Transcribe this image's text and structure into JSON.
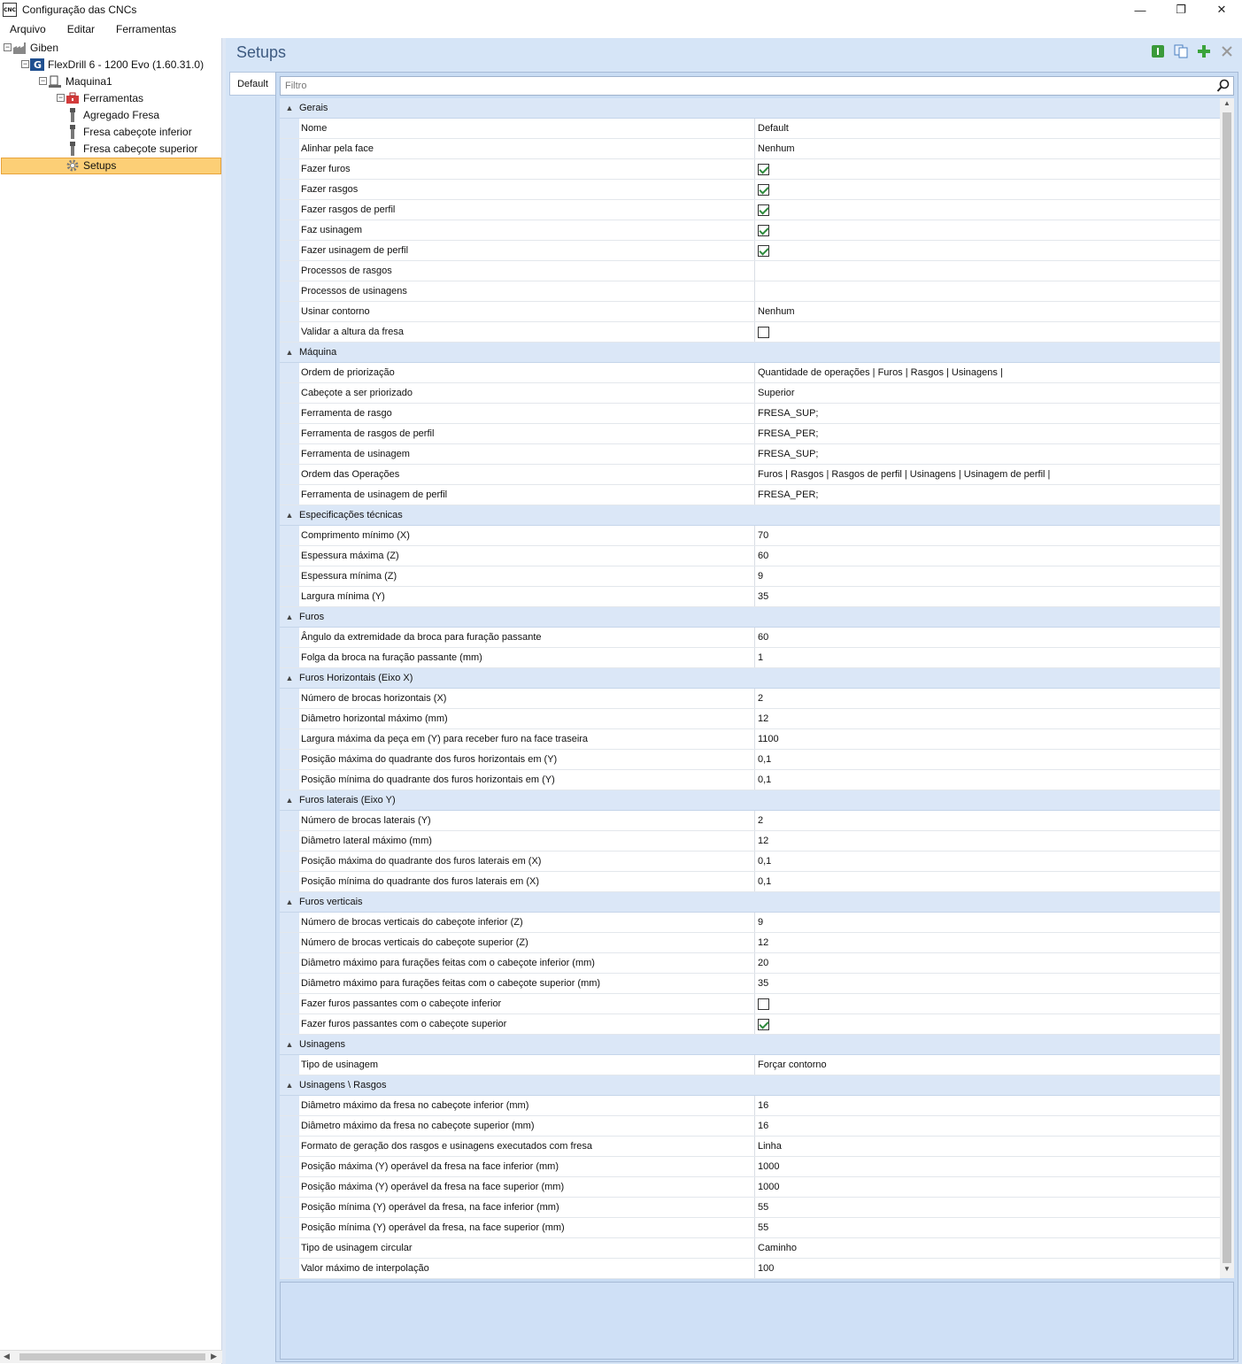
{
  "window": {
    "title": "Configuração das CNCs",
    "icon_label": "CNC"
  },
  "menu": [
    "Arquivo",
    "Editar",
    "Ferramentas"
  ],
  "tree": [
    {
      "label": "Giben",
      "icon": "factory-icon",
      "level": 0,
      "expander": "⊟"
    },
    {
      "label": "FlexDrill 6 - 1200 Evo (1.60.31.0)",
      "icon": "machine-logo-icon",
      "level": 1,
      "expander": "⊟"
    },
    {
      "label": "Maquina1",
      "icon": "machine-icon",
      "level": 2,
      "expander": "⊟"
    },
    {
      "label": "Ferramentas",
      "icon": "toolbox-icon",
      "level": 3,
      "expander": "⊟"
    },
    {
      "label": "Agregado Fresa",
      "icon": "tool-icon",
      "level": 4
    },
    {
      "label": "Fresa cabeçote inferior",
      "icon": "tool-icon",
      "level": 4
    },
    {
      "label": "Fresa cabeçote superior",
      "icon": "tool-icon",
      "level": 4
    },
    {
      "label": "Setups",
      "icon": "gear-icon",
      "level": 3,
      "selected": true
    }
  ],
  "header": {
    "title": "Setups"
  },
  "tabs": [
    "Default"
  ],
  "filter": {
    "placeholder": "Filtro"
  },
  "grid": [
    {
      "category": "Gerais",
      "rows": [
        {
          "name": "Nome",
          "value": "Default"
        },
        {
          "name": "Alinhar pela face",
          "value": "Nenhum"
        },
        {
          "name": "Fazer furos",
          "check": true
        },
        {
          "name": "Fazer rasgos",
          "check": true
        },
        {
          "name": "Fazer rasgos de perfil",
          "check": true
        },
        {
          "name": "Faz usinagem",
          "check": true
        },
        {
          "name": "Fazer usinagem de perfil",
          "check": true
        },
        {
          "name": "Processos de rasgos",
          "value": ""
        },
        {
          "name": "Processos de usinagens",
          "value": ""
        },
        {
          "name": "Usinar contorno",
          "value": "Nenhum"
        },
        {
          "name": "Validar a altura da fresa",
          "check": false
        }
      ]
    },
    {
      "category": "Máquina",
      "rows": [
        {
          "name": "Ordem de priorização",
          "value": "Quantidade de operações | Furos | Rasgos | Usinagens |"
        },
        {
          "name": "Cabeçote a ser priorizado",
          "value": "Superior"
        },
        {
          "name": "Ferramenta de rasgo",
          "value": "FRESA_SUP;"
        },
        {
          "name": "Ferramenta de rasgos de perfil",
          "value": "FRESA_PER;"
        },
        {
          "name": "Ferramenta de usinagem",
          "value": "FRESA_SUP;"
        },
        {
          "name": "Ordem das Operações",
          "value": "Furos | Rasgos | Rasgos de perfil | Usinagens | Usinagem de perfil |"
        },
        {
          "name": "Ferramenta de usinagem de perfil",
          "value": "FRESA_PER;"
        }
      ]
    },
    {
      "category": "Especificações técnicas",
      "rows": [
        {
          "name": "Comprimento mínimo (X)",
          "value": "70"
        },
        {
          "name": "Espessura máxima (Z)",
          "value": "60"
        },
        {
          "name": "Espessura mínima (Z)",
          "value": "9"
        },
        {
          "name": "Largura mínima (Y)",
          "value": "35"
        }
      ]
    },
    {
      "category": "Furos",
      "rows": [
        {
          "name": "Ângulo da extremidade da broca para furação passante",
          "value": "60"
        },
        {
          "name": "Folga da broca na furação passante (mm)",
          "value": "1"
        }
      ]
    },
    {
      "category": "Furos Horizontais (Eixo X)",
      "rows": [
        {
          "name": "Número de brocas horizontais (X)",
          "value": "2"
        },
        {
          "name": "Diâmetro horizontal máximo (mm)",
          "value": "12"
        },
        {
          "name": "Largura máxima da peça em (Y) para receber furo na face traseira",
          "value": "1100"
        },
        {
          "name": "Posição máxima do quadrante dos furos horizontais em (Y)",
          "value": "0,1"
        },
        {
          "name": "Posição mínima do quadrante dos furos horizontais em (Y)",
          "value": "0,1"
        }
      ]
    },
    {
      "category": "Furos laterais (Eixo Y)",
      "rows": [
        {
          "name": "Número de brocas laterais (Y)",
          "value": "2"
        },
        {
          "name": "Diâmetro lateral máximo (mm)",
          "value": "12"
        },
        {
          "name": "Posição máxima do quadrante dos furos laterais em (X)",
          "value": "0,1"
        },
        {
          "name": "Posição mínima do quadrante dos furos laterais em (X)",
          "value": "0,1"
        }
      ]
    },
    {
      "category": "Furos verticais",
      "rows": [
        {
          "name": "Número de brocas verticais do cabeçote inferior (Z)",
          "value": "9"
        },
        {
          "name": "Número de brocas verticais do cabeçote superior (Z)",
          "value": "12"
        },
        {
          "name": "Diâmetro máximo para furações feitas com o cabeçote inferior (mm)",
          "value": "20"
        },
        {
          "name": "Diâmetro máximo para furações feitas com o cabeçote superior (mm)",
          "value": "35"
        },
        {
          "name": "Fazer furos passantes com o cabeçote inferior",
          "check": false
        },
        {
          "name": "Fazer furos passantes com o cabeçote superior",
          "check": true
        }
      ]
    },
    {
      "category": "Usinagens",
      "rows": [
        {
          "name": "Tipo de usinagem",
          "value": "Forçar contorno"
        }
      ]
    },
    {
      "category": "Usinagens \\ Rasgos",
      "rows": [
        {
          "name": "Diâmetro máximo da fresa no cabeçote inferior (mm)",
          "value": "16"
        },
        {
          "name": "Diâmetro máximo da fresa no cabeçote superior (mm)",
          "value": "16"
        },
        {
          "name": "Formato de geração dos rasgos e usinagens executados com fresa",
          "value": "Linha"
        },
        {
          "name": "Posição máxima (Y) operável da fresa na face inferior (mm)",
          "value": "1000"
        },
        {
          "name": "Posição máxima (Y) operável da fresa na face superior (mm)",
          "value": "1000"
        },
        {
          "name": "Posição mínima (Y) operável da fresa, na face inferior (mm)",
          "value": "55"
        },
        {
          "name": "Posição mínima (Y) operável da fresa, na face superior (mm)",
          "value": "55"
        },
        {
          "name": "Tipo de usinagem circular",
          "value": "Caminho"
        },
        {
          "name": "Valor máximo de interpolação",
          "value": "100"
        }
      ]
    }
  ]
}
